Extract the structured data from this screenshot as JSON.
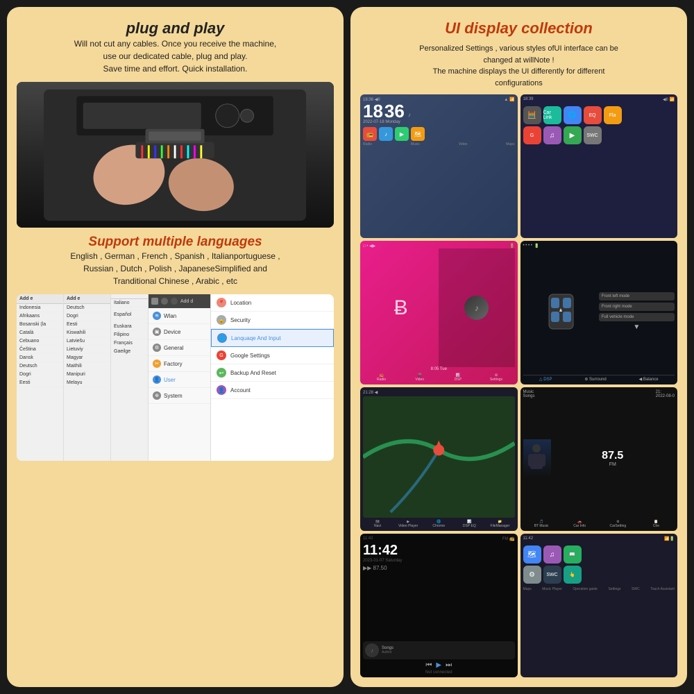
{
  "left": {
    "plug_title": "plug and play",
    "plug_body": "Will not cut any cables. Once you receive the machine,\nuse our dedicated cable, plug and play.\nSave time and effort. Quick installation.",
    "multilang_title": "Support multiple languages",
    "multilang_body": "English , German , French , Spanish , Italianportuguese ,\nRussian , Dutch , Polish , JapaneseSimplified and\nTranditional Chinese , Arabic , etc",
    "lang_col1": {
      "header": "Add e",
      "items": [
        "Indonesia",
        "Afrikaans",
        "Bosanski (la",
        "Català",
        "Cebuano",
        "Čeština",
        "Dansk",
        "Deutsch",
        "Dogri",
        "Eesti"
      ]
    },
    "lang_col2": {
      "header": "Add e",
      "items": [
        "Deutsch",
        "Dogri",
        "Eesti",
        "Kiswahili",
        "Latviešu",
        "Lietuviy",
        "Magyar",
        "Maithili",
        "Manipuri",
        "Melayu"
      ]
    },
    "lang_col3": {
      "items": [
        "Italiano",
        "",
        "Español",
        "",
        "Euskara",
        "Filipino",
        "Français",
        "Gaeilge"
      ]
    },
    "settings_menu": {
      "header_label": "Add d",
      "items": [
        {
          "label": "Wlan",
          "icon": "wifi"
        },
        {
          "label": "Device",
          "icon": "device"
        },
        {
          "label": "General",
          "icon": "gear"
        },
        {
          "label": "Factory",
          "icon": "factory"
        },
        {
          "label": "User",
          "icon": "user"
        },
        {
          "label": "System",
          "icon": "system"
        }
      ]
    },
    "settings_detail": {
      "items": [
        {
          "label": "Location",
          "icon": "📍"
        },
        {
          "label": "Security",
          "icon": "🔒"
        },
        {
          "label": "Lanquaqe And Input",
          "icon": "🌐",
          "highlighted": true
        },
        {
          "label": "Google Settings",
          "icon": "G"
        },
        {
          "label": "Backup And Reset",
          "icon": "↩"
        },
        {
          "label": "Account",
          "icon": "👤"
        }
      ]
    }
  },
  "right": {
    "ui_title": "UI display collection",
    "ui_description": "Personalized Settings , various styles ofUI interface can be\nchanged at willNote !\nThe machine displays the UI differently for different\nconfigurations",
    "cells": [
      {
        "id": "clock-home",
        "time": "18 36",
        "date": "2022-07-18  Monday",
        "top_status": "18:36 ◀ II",
        "app_labels": [
          "Radio",
          "Music",
          "Video",
          "Maps"
        ]
      },
      {
        "id": "app-grid",
        "top_status": "18:39 ◀ II",
        "apps": [
          "Calculator",
          "Car Link 2.0",
          "Chrome",
          "Equalizer",
          "Fla",
          "Google",
          "Music Player",
          "Play Store",
          "SWC"
        ]
      },
      {
        "id": "bluetooth-music",
        "symbol": "⚡",
        "time": "8:05",
        "day": "Tue",
        "bottom_labels": [
          "Radio",
          "Video",
          "DSP",
          "Settings"
        ]
      },
      {
        "id": "car-seat",
        "label": "DSP",
        "surround": "⊛ Surround",
        "balance": "◀ Balance",
        "modes": [
          "Front left mode",
          "Front right mode",
          "Full vehicle mode"
        ]
      },
      {
        "id": "navigation",
        "time": "21:28",
        "bottom_labels": [
          "Navi",
          "Video Player",
          "Chrome",
          "DSP Equalizer",
          "FileManager"
        ]
      },
      {
        "id": "music-person",
        "time": "21:",
        "date": "2022-08-0",
        "right_value": "87.5",
        "bottom_labels": [
          "BT Music",
          "Car Info",
          "CarSetting",
          "Che"
        ]
      },
      {
        "id": "dark-clock",
        "time": "11:42",
        "date": "2023-01-07  Saturday",
        "freq": "87.50",
        "bottom_labels": [
          "Songs\nAuthor"
        ]
      },
      {
        "id": "app-grid2",
        "time": "11:42",
        "apps": [
          "Maps",
          "Music Player",
          "Operation guide",
          "Settings",
          "SWC",
          "Touch Assistant"
        ]
      }
    ]
  }
}
